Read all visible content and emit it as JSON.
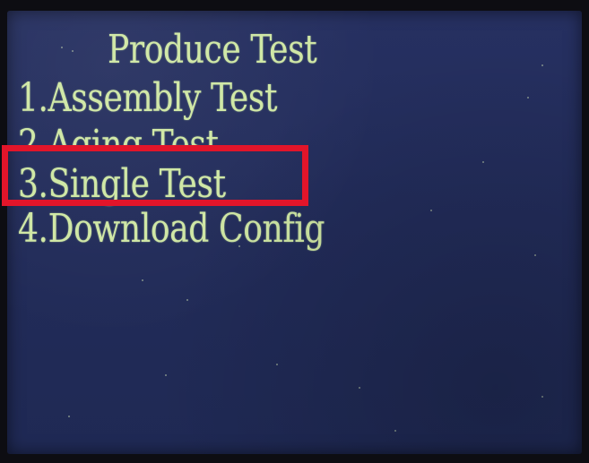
{
  "screen": {
    "title": "Produce Test",
    "menu_items": [
      {
        "label": "1.Assembly Test"
      },
      {
        "label": "2.Aging Test"
      },
      {
        "label": "3.Single Test"
      },
      {
        "label": "4.Download Config"
      }
    ]
  },
  "colors": {
    "lcd_background": "#222c5a",
    "lcd_text": "#cfe7a4",
    "highlight": "#e2152a"
  }
}
